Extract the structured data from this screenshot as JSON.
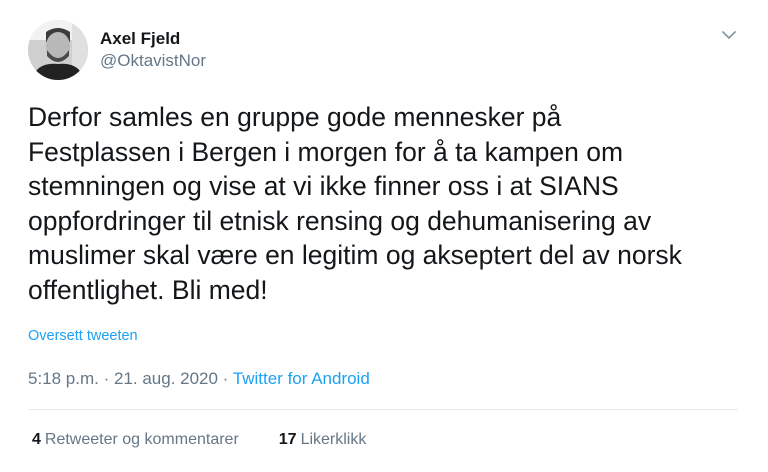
{
  "user": {
    "display_name": "Axel Fjeld",
    "handle": "@OktavistNor"
  },
  "tweet": {
    "text": "Derfor samles en gruppe gode mennesker på\nFestplassen i Bergen i morgen for å ta kampen om\nstemningen og vise at vi ikke finner oss i at SIANS\noppfordringer til etnisk rensing og dehumanisering av\nmuslimer skal være en legitim og akseptert del av norsk\noffentlighet. Bli med!",
    "translate_label": "Oversett tweeten",
    "time": "5:18 p.m.",
    "separator": " · ",
    "date": "21. aug. 2020",
    "source": "Twitter for Android"
  },
  "stats": {
    "retweets_count": "4",
    "retweets_label": "Retweeter og kommentarer",
    "likes_count": "17",
    "likes_label": "Likerklikk"
  },
  "icons": {
    "caret": "chevron-down-icon",
    "avatar": "user-avatar"
  },
  "colors": {
    "link": "#1da1f2",
    "secondary_text": "#657786",
    "divider": "#e6ecf0"
  }
}
